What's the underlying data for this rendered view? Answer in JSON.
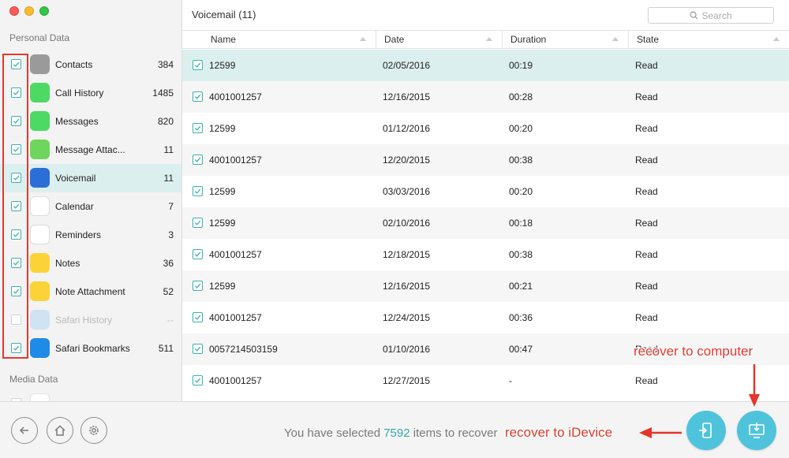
{
  "sidebar": {
    "personal_title": "Personal Data",
    "media_title": "Media Data",
    "items": [
      {
        "label": "Contacts",
        "count": "384",
        "checked": true,
        "icon": "contacts-icon",
        "color": "#9a9a9a"
      },
      {
        "label": "Call History",
        "count": "1485",
        "checked": true,
        "icon": "phone-icon",
        "color": "#4cd964"
      },
      {
        "label": "Messages",
        "count": "820",
        "checked": true,
        "icon": "message-icon",
        "color": "#4cd964"
      },
      {
        "label": "Message Attac...",
        "count": "11",
        "checked": true,
        "icon": "attachment-icon",
        "color": "#6ed65c"
      },
      {
        "label": "Voicemail",
        "count": "11",
        "checked": true,
        "icon": "voicemail-icon",
        "color": "#2b6fd6",
        "active": true
      },
      {
        "label": "Calendar",
        "count": "7",
        "checked": true,
        "icon": "calendar-icon",
        "color": "#ffffff"
      },
      {
        "label": "Reminders",
        "count": "3",
        "checked": true,
        "icon": "reminders-icon",
        "color": "#ffffff"
      },
      {
        "label": "Notes",
        "count": "36",
        "checked": true,
        "icon": "notes-icon",
        "color": "#fbd338"
      },
      {
        "label": "Note Attachment",
        "count": "52",
        "checked": true,
        "icon": "note-attachment-icon",
        "color": "#fbd338"
      },
      {
        "label": "Safari History",
        "count": "--",
        "checked": false,
        "icon": "safari-history-icon",
        "color": "#cfe3f3",
        "disabled": true
      },
      {
        "label": "Safari Bookmarks",
        "count": "511",
        "checked": true,
        "icon": "safari-bookmarks-icon",
        "color": "#1f8be6"
      }
    ]
  },
  "main": {
    "title": "Voicemail (11)",
    "search_placeholder": "Search",
    "columns": [
      "Name",
      "Date",
      "Duration",
      "State"
    ],
    "rows": [
      {
        "name": "12599",
        "date": "02/05/2016",
        "duration": "00:19",
        "state": "Read"
      },
      {
        "name": "4001001257",
        "date": "12/16/2015",
        "duration": "00:28",
        "state": "Read"
      },
      {
        "name": "12599",
        "date": "01/12/2016",
        "duration": "00:20",
        "state": "Read"
      },
      {
        "name": "4001001257",
        "date": "12/20/2015",
        "duration": "00:38",
        "state": "Read"
      },
      {
        "name": "12599",
        "date": "03/03/2016",
        "duration": "00:20",
        "state": "Read"
      },
      {
        "name": "12599",
        "date": "02/10/2016",
        "duration": "00:18",
        "state": "Read"
      },
      {
        "name": "4001001257",
        "date": "12/18/2015",
        "duration": "00:38",
        "state": "Read"
      },
      {
        "name": "12599",
        "date": "12/16/2015",
        "duration": "00:21",
        "state": "Read"
      },
      {
        "name": "4001001257",
        "date": "12/24/2015",
        "duration": "00:36",
        "state": "Read"
      },
      {
        "name": "0057214503159",
        "date": "01/10/2016",
        "duration": "00:47",
        "state": "Read"
      },
      {
        "name": "4001001257",
        "date": "12/27/2015",
        "duration": "-",
        "state": "Read"
      }
    ]
  },
  "bottom": {
    "status_prefix": "You have selected ",
    "selected_count": "7592",
    "status_suffix": " items to recover"
  },
  "annotations": {
    "to_computer": "recover to computer",
    "to_idevice": "recover to iDevice"
  },
  "colors": {
    "accent": "#2fa8a6",
    "annotation": "#e5352a",
    "recover_button": "#4fc3dc"
  }
}
